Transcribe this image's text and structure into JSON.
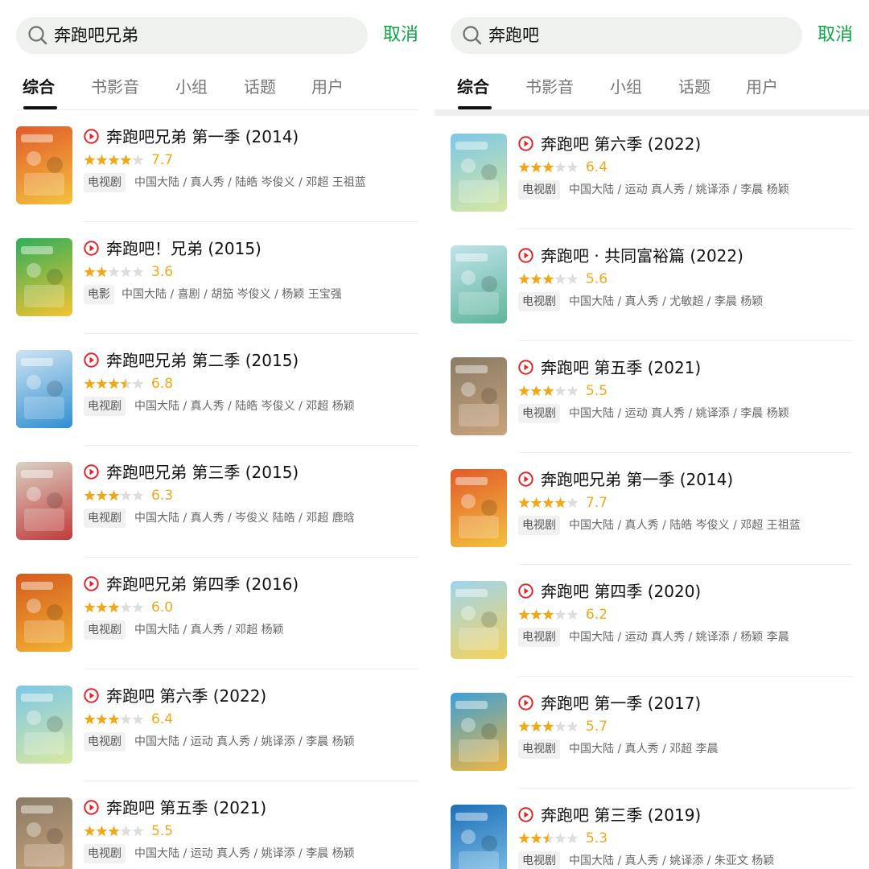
{
  "colors": {
    "accent_green": "#0ea344",
    "rating_orange": "#f0a81a",
    "play_red": "#e0262b",
    "star_empty": "#dddddd"
  },
  "icons": {
    "search": "search-icon",
    "play": "play-icon",
    "star": "star-icon"
  },
  "panels": [
    {
      "search": {
        "query": "奔跑吧兄弟"
      },
      "cancel_label": "取消",
      "tabs": [
        {
          "label": "综合",
          "active": true
        },
        {
          "label": "书影音"
        },
        {
          "label": "小组"
        },
        {
          "label": "话题"
        },
        {
          "label": "用户"
        }
      ],
      "results": [
        {
          "title": "奔跑吧兄弟 第一季 (2014)",
          "rating": "7.7",
          "stars": 4,
          "type": "电视剧",
          "meta": "中国大陆 / 真人秀 / 陆皓 岑俊义 / 邓超 王祖蓝",
          "poster": [
            "#e25a2a",
            "#f3c23d"
          ]
        },
        {
          "title": "奔跑吧！兄弟 (2015)",
          "rating": "3.6",
          "stars": 2,
          "type": "电影",
          "meta": "中国大陆 / 喜剧 / 胡笳 岑俊义 / 杨颖 王宝强",
          "poster": [
            "#2fae5a",
            "#f4c430"
          ]
        },
        {
          "title": "奔跑吧兄弟 第二季 (2015)",
          "rating": "6.8",
          "stars": 3.5,
          "type": "电视剧",
          "meta": "中国大陆 / 真人秀 / 陆皓 岑俊义 / 邓超 杨颖",
          "poster": [
            "#cfe4f2",
            "#2f8fd0"
          ]
        },
        {
          "title": "奔跑吧兄弟 第三季 (2015)",
          "rating": "6.3",
          "stars": 3,
          "type": "电视剧",
          "meta": "中国大陆 / 真人秀 / 岑俊义 陆皓 / 邓超 鹿晗",
          "poster": [
            "#d9d2c4",
            "#c23a3a"
          ]
        },
        {
          "title": "奔跑吧兄弟 第四季 (2016)",
          "rating": "6.0",
          "stars": 3,
          "type": "电视剧",
          "meta": "中国大陆 / 真人秀 / 邓超 杨颖",
          "poster": [
            "#d45a1e",
            "#f2b233"
          ]
        },
        {
          "title": "奔跑吧 第六季 (2022)",
          "rating": "6.4",
          "stars": 3,
          "type": "电视剧",
          "meta": "中国大陆 / 运动 真人秀 / 姚译添 / 李晨 杨颖",
          "poster": [
            "#7cc7e8",
            "#d8e8a0"
          ]
        },
        {
          "title": "奔跑吧 第五季 (2021)",
          "rating": "5.5",
          "stars": 3,
          "type": "电视剧",
          "meta": "中国大陆 / 运动 真人秀 / 姚译添 / 李晨 杨颖",
          "poster": [
            "#8a7b66",
            "#c9a37a"
          ]
        }
      ]
    },
    {
      "search": {
        "query": "奔跑吧"
      },
      "cancel_label": "取消",
      "tabs": [
        {
          "label": "综合",
          "active": true
        },
        {
          "label": "书影音"
        },
        {
          "label": "小组"
        },
        {
          "label": "话题"
        },
        {
          "label": "用户"
        }
      ],
      "results": [
        {
          "title": "奔跑吧 第六季 (2022)",
          "rating": "6.4",
          "stars": 3,
          "type": "电视剧",
          "meta": "中国大陆 / 运动 真人秀 / 姚译添 / 李晨 杨颖",
          "poster": [
            "#7cc7e8",
            "#d8e8a0"
          ]
        },
        {
          "title": "奔跑吧 · 共同富裕篇 (2022)",
          "rating": "5.6",
          "stars": 3,
          "type": "电视剧",
          "meta": "中国大陆 / 真人秀 / 尤敏超 / 李晨 杨颖",
          "poster": [
            "#bfe3ea",
            "#5fb59a"
          ]
        },
        {
          "title": "奔跑吧 第五季 (2021)",
          "rating": "5.5",
          "stars": 3,
          "type": "电视剧",
          "meta": "中国大陆 / 运动 真人秀 / 姚译添 / 李晨 杨颖",
          "poster": [
            "#8a7b66",
            "#c9a37a"
          ]
        },
        {
          "title": "奔跑吧兄弟 第一季 (2014)",
          "rating": "7.7",
          "stars": 4,
          "type": "电视剧",
          "meta": "中国大陆 / 真人秀 / 陆皓 岑俊义 / 邓超 王祖蓝",
          "poster": [
            "#e25a2a",
            "#f3c23d"
          ]
        },
        {
          "title": "奔跑吧 第四季 (2020)",
          "rating": "6.2",
          "stars": 3,
          "type": "电视剧",
          "meta": "中国大陆 / 运动 真人秀 / 姚译添 / 杨颖 李晨",
          "poster": [
            "#9fd4ef",
            "#f5d35a"
          ]
        },
        {
          "title": "奔跑吧 第一季 (2017)",
          "rating": "5.7",
          "stars": 3,
          "type": "电视剧",
          "meta": "中国大陆 / 真人秀 / 邓超 李晨",
          "poster": [
            "#3aa0d8",
            "#f0b640"
          ]
        },
        {
          "title": "奔跑吧 第三季 (2019)",
          "rating": "5.3",
          "stars": 2.5,
          "type": "电视剧",
          "meta": "中国大陆 / 真人秀 / 姚译添 / 朱亚文 杨颖",
          "poster": [
            "#1d6fb8",
            "#7fc3ea"
          ]
        }
      ]
    }
  ]
}
